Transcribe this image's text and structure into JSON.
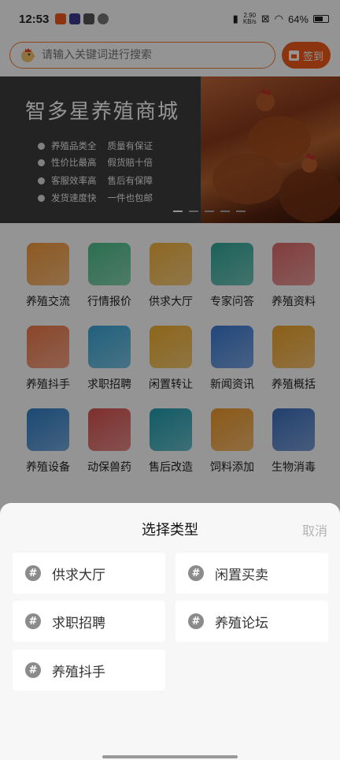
{
  "status": {
    "time": "12:53",
    "net_speed_value": "2.90",
    "net_speed_unit": "KB/s",
    "battery": "64%",
    "battery_level": 0.64
  },
  "search": {
    "placeholder": "请输入关键词进行搜索",
    "signin_label": "签到"
  },
  "banner": {
    "title": "智多星养殖商城",
    "features": [
      {
        "a": "养殖品类全",
        "b": "质量有保证"
      },
      {
        "a": "性价比最高",
        "b": "假货赔十倍"
      },
      {
        "a": "客服效率高",
        "b": "售后有保障"
      },
      {
        "a": "发货速度快",
        "b": "一件也包邮"
      }
    ],
    "slide_count": 5,
    "active_slide": 1
  },
  "grid": [
    {
      "label": "养殖交流",
      "icon": "chat-hen-icon",
      "color": "#f39a3a"
    },
    {
      "label": "行情报价",
      "icon": "chart-icon",
      "color": "#4cbf8a"
    },
    {
      "label": "供求大厅",
      "icon": "shopping-bag-icon",
      "color": "#f4b33d"
    },
    {
      "label": "专家问答",
      "icon": "expert-icon",
      "color": "#2fa99a"
    },
    {
      "label": "养殖资料",
      "icon": "document-search-icon",
      "color": "#e06a6a"
    },
    {
      "label": "养殖抖手",
      "icon": "video-icon",
      "color": "#f07a4a"
    },
    {
      "label": "求职招聘",
      "icon": "id-badge-icon",
      "color": "#3aa7d8"
    },
    {
      "label": "闲置转让",
      "icon": "briefcase-icon",
      "color": "#f2b02e"
    },
    {
      "label": "新闻资讯",
      "icon": "globe-icon",
      "color": "#3a7bd5"
    },
    {
      "label": "养殖概括",
      "icon": "chick-coin-icon",
      "color": "#f0a52a"
    },
    {
      "label": "养殖设备",
      "icon": "fan-icon",
      "color": "#2f7fc9"
    },
    {
      "label": "动保兽药",
      "icon": "medicine-bottle-icon",
      "color": "#d9534f"
    },
    {
      "label": "售后改造",
      "icon": "gear-icon",
      "color": "#1f9eb0"
    },
    {
      "label": "饲料添加",
      "icon": "flask-icon",
      "color": "#f09a2a"
    },
    {
      "label": "生物消毒",
      "icon": "shield-icon",
      "color": "#3a6fc0"
    }
  ],
  "sheet": {
    "title": "选择类型",
    "cancel_label": "取消",
    "options": [
      {
        "label": "供求大厅"
      },
      {
        "label": "闲置买卖"
      },
      {
        "label": "求职招聘"
      },
      {
        "label": "养殖论坛"
      },
      {
        "label": "养殖抖手"
      }
    ]
  },
  "colors": {
    "accent": "#f05a1a",
    "search_border": "#f07c2e",
    "hash_badge": "#8b8b8b",
    "cancel_text": "#b3b3b3"
  }
}
